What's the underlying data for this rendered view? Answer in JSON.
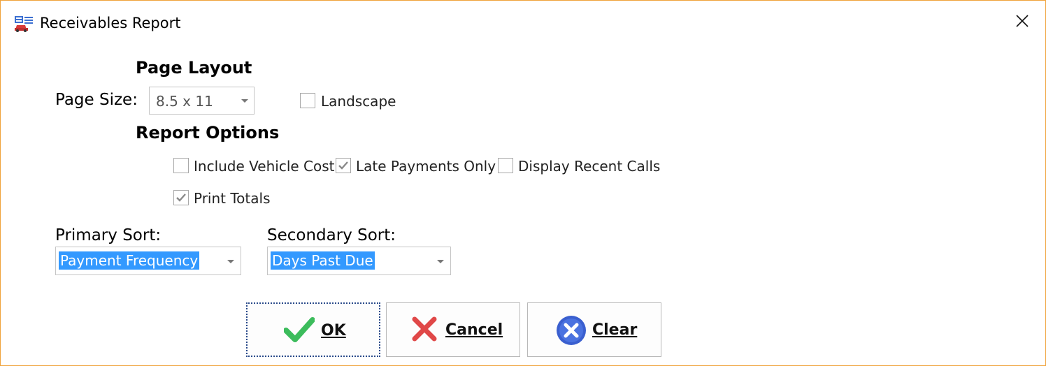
{
  "window": {
    "title": "Receivables Report"
  },
  "page_layout": {
    "heading": "Page Layout",
    "page_size_label": "Page Size:",
    "page_size_value": "8.5 x 11",
    "landscape_label": "Landscape",
    "landscape_checked": false
  },
  "report_options": {
    "heading": "Report Options",
    "include_vehicle_cost": {
      "label": "Include Vehicle Cost",
      "checked": false
    },
    "late_payments_only": {
      "label": "Late Payments Only",
      "checked": true
    },
    "display_recent_calls": {
      "label": "Display Recent Calls",
      "checked": false
    },
    "print_totals": {
      "label": "Print Totals",
      "checked": true
    }
  },
  "sort": {
    "primary_label": "Primary Sort:",
    "primary_value": "Payment Frequency",
    "secondary_label": "Secondary Sort:",
    "secondary_value": "Days Past Due"
  },
  "buttons": {
    "ok": "OK",
    "cancel": "Cancel",
    "clear": "Clear"
  },
  "colors": {
    "window_border": "#f0a23a",
    "selection_highlight": "#3399ff",
    "ok_icon": "#3cbc5c",
    "cancel_icon": "#e04848",
    "clear_icon": "#3a5fcf"
  },
  "icons": {
    "app": "report-car-icon",
    "close": "close-icon",
    "ok": "checkmark-icon",
    "cancel": "x-icon",
    "clear": "circle-x-icon"
  }
}
